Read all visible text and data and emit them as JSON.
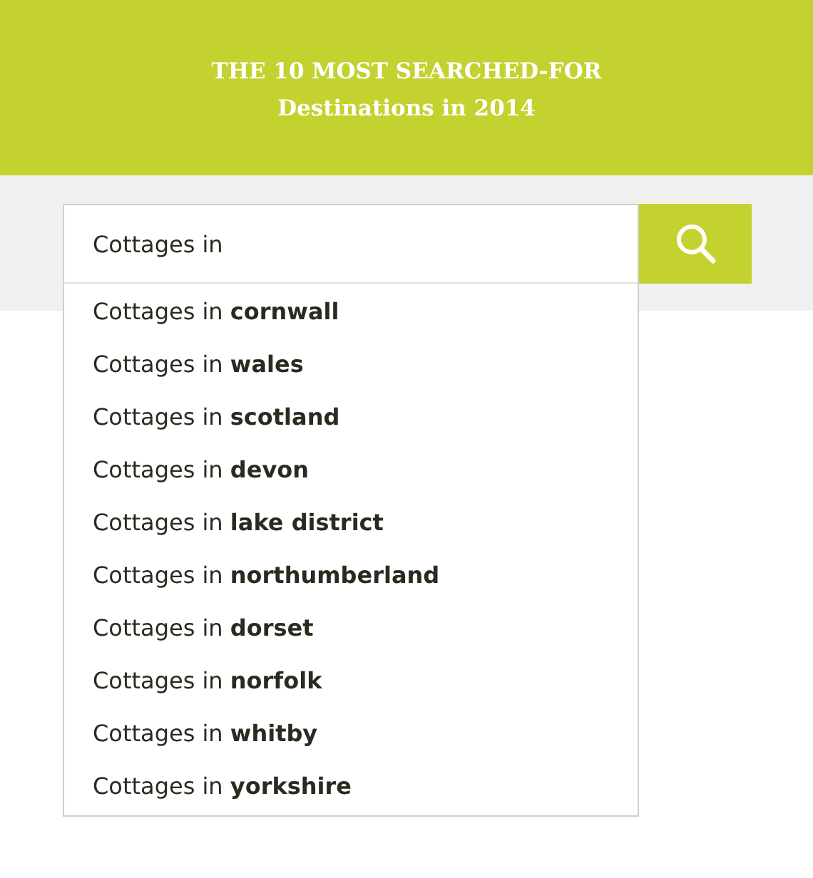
{
  "header": {
    "title_lines": [
      "THE 10 MOST SEARCHED-FOR",
      "Destinations in 2014"
    ]
  },
  "search": {
    "value": "Cottages in"
  },
  "suggestions": [
    "Cottages in **cornwall**",
    "Cottages in **wales**",
    "Cottages in **scotland**",
    "Cottages in **devon**",
    "Cottages in **lake district**",
    "Cottages in **northumberland**",
    "Cottages in **dorset**",
    "Cottages in **norfolk**",
    "Cottages in **whitby**",
    "Cottages in **yorkshire**"
  ]
}
